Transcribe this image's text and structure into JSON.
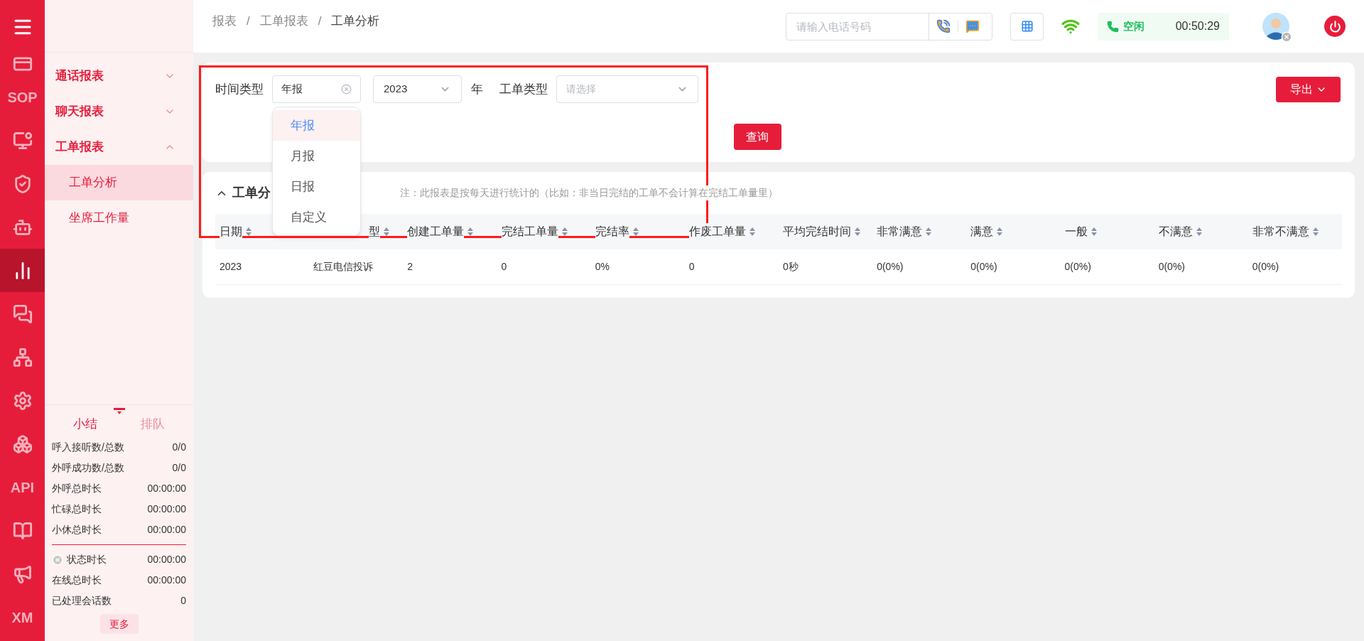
{
  "rail": {
    "items": [
      {
        "kind": "icon",
        "selected": false
      },
      {
        "kind": "icon",
        "selected": false
      },
      {
        "kind": "text",
        "label": "SOP",
        "selected": false
      },
      {
        "kind": "icon",
        "selected": false
      },
      {
        "kind": "icon",
        "selected": false
      },
      {
        "kind": "icon",
        "selected": false
      },
      {
        "kind": "icon",
        "selected": true
      },
      {
        "kind": "icon",
        "selected": false
      },
      {
        "kind": "icon",
        "selected": false
      },
      {
        "kind": "icon",
        "selected": false
      },
      {
        "kind": "icon",
        "selected": false
      },
      {
        "kind": "text",
        "label": "API",
        "selected": false
      },
      {
        "kind": "icon",
        "selected": false
      },
      {
        "kind": "icon",
        "selected": false
      },
      {
        "kind": "text",
        "label": "XM",
        "selected": false
      }
    ]
  },
  "sidebar": {
    "groups": [
      {
        "label": "通话报表",
        "expanded": false
      },
      {
        "label": "聊天报表",
        "expanded": false
      },
      {
        "label": "工单报表",
        "expanded": true,
        "children": [
          {
            "label": "工单分析",
            "selected": true
          },
          {
            "label": "坐席工作量",
            "selected": false
          }
        ]
      }
    ],
    "summary": {
      "tabs": [
        {
          "label": "小结",
          "selected": true
        },
        {
          "label": "排队",
          "selected": false
        }
      ],
      "stats": [
        {
          "kind": "plain",
          "label": "呼入接听数/总数",
          "value": "0/0"
        },
        {
          "kind": "plain",
          "label": "外呼成功数/总数",
          "value": "0/0"
        },
        {
          "kind": "plain",
          "label": "外呼总时长",
          "value": "00:00:00"
        },
        {
          "kind": "plain",
          "label": "忙碌总时长",
          "value": "00:00:00"
        },
        {
          "kind": "plain",
          "label": "小休总时长",
          "value": "00:00:00"
        },
        {
          "kind": "divider"
        },
        {
          "kind": "status",
          "label": "状态时长",
          "value": "00:00:00"
        },
        {
          "kind": "plain",
          "label": "在线总时长",
          "value": "00:00:00"
        },
        {
          "kind": "plain",
          "label": "已处理会话数",
          "value": "0"
        }
      ],
      "more_button": "更多"
    }
  },
  "topbar": {
    "breadcrumb": [
      "报表",
      "工单报表",
      "工单分析"
    ],
    "separator": "/",
    "phone_field": {
      "placeholder": "请输入电话号码"
    },
    "status": {
      "label": "空闲",
      "time": "00:50:29"
    }
  },
  "filter": {
    "time_type": {
      "label": "时间类型",
      "value": "年报"
    },
    "year": {
      "value": "2023",
      "unit": "年"
    },
    "ticket_type": {
      "label": "工单类型",
      "placeholder": "请选择"
    },
    "export_button": "导出",
    "query_button": "查询",
    "dropdown": {
      "options": [
        {
          "label": "年报",
          "selected": true
        },
        {
          "label": "月报",
          "selected": false
        },
        {
          "label": "日报",
          "selected": false
        },
        {
          "label": "自定义",
          "selected": false
        }
      ]
    }
  },
  "report": {
    "title": "工单分",
    "expanded": true,
    "note": "注：此报表是按每天进行统计的（比如：非当日完结的工单不会计算在完结工单量里）",
    "table": {
      "columns": [
        "日期",
        "型",
        "创建工单量",
        "完结工单量",
        "完结率",
        "作废工单量",
        "平均完结时间",
        "非常满意",
        "满意",
        "一般",
        "不满意",
        "非常不满意"
      ],
      "rows": [
        [
          "2023",
          "红豆电信投诉",
          "2",
          "0",
          "0%",
          "0",
          "0秒",
          "0(0%)",
          "0(0%)",
          "0(0%)",
          "0(0%)",
          "0(0%)"
        ]
      ]
    }
  }
}
